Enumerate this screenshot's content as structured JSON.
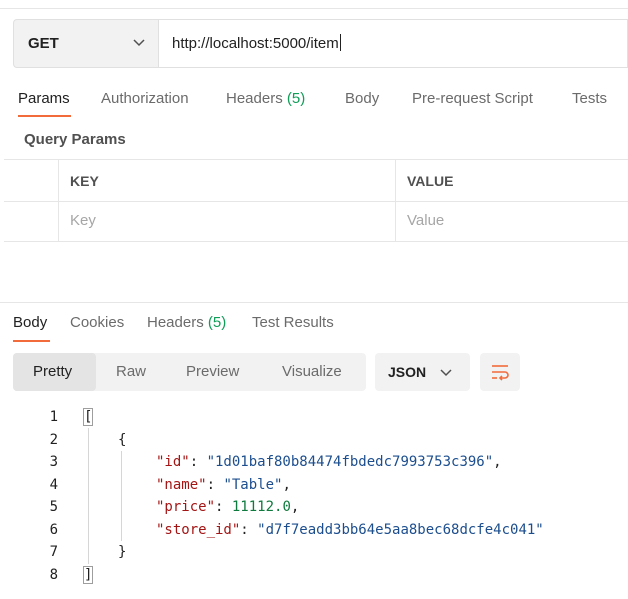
{
  "request": {
    "method": "GET",
    "url": "http://localhost:5000/item"
  },
  "request_tabs": [
    {
      "label": "Params",
      "active": true
    },
    {
      "label": "Authorization"
    },
    {
      "label": "Headers ",
      "count": "(5)"
    },
    {
      "label": "Body"
    },
    {
      "label": "Pre-request Script"
    },
    {
      "label": "Tests"
    }
  ],
  "query_params": {
    "title": "Query Params",
    "col_key": "KEY",
    "col_value": "VALUE",
    "key_placeholder": "Key",
    "value_placeholder": "Value"
  },
  "response_tabs": [
    {
      "label": "Body",
      "active": true
    },
    {
      "label": "Cookies"
    },
    {
      "label": "Headers ",
      "count": "(5)"
    },
    {
      "label": "Test Results"
    }
  ],
  "format_tabs": [
    {
      "label": "Pretty",
      "active": true
    },
    {
      "label": "Raw"
    },
    {
      "label": "Preview"
    },
    {
      "label": "Visualize"
    }
  ],
  "language": "JSON",
  "body": {
    "line_numbers": [
      "1",
      "2",
      "3",
      "4",
      "5",
      "6",
      "7",
      "8"
    ],
    "open_array": "[",
    "open_obj": "{",
    "fields": [
      {
        "key": "\"id\"",
        "value": "\"1d01baf80b84474fbdedc7993753c396\"",
        "type": "string",
        "sep": ","
      },
      {
        "key": "\"name\"",
        "value": "\"Table\"",
        "type": "string",
        "sep": ","
      },
      {
        "key": "\"price\"",
        "value": "11112.0",
        "type": "number",
        "sep": ","
      },
      {
        "key": "\"store_id\"",
        "value": "\"d7f7eadd3bb64e5aa8bec68dcfe4c041\"",
        "type": "string",
        "sep": ""
      }
    ],
    "close_obj": "}",
    "close_array": "]"
  },
  "colors": {
    "accent": "#f26b3a",
    "count_green": "#0f9d58",
    "json_key": "#a31515",
    "json_string": "#1c4e8e",
    "json_number": "#0e7a3d"
  },
  "icons": [
    "chevron-down-icon",
    "wrap-lines-icon"
  ]
}
